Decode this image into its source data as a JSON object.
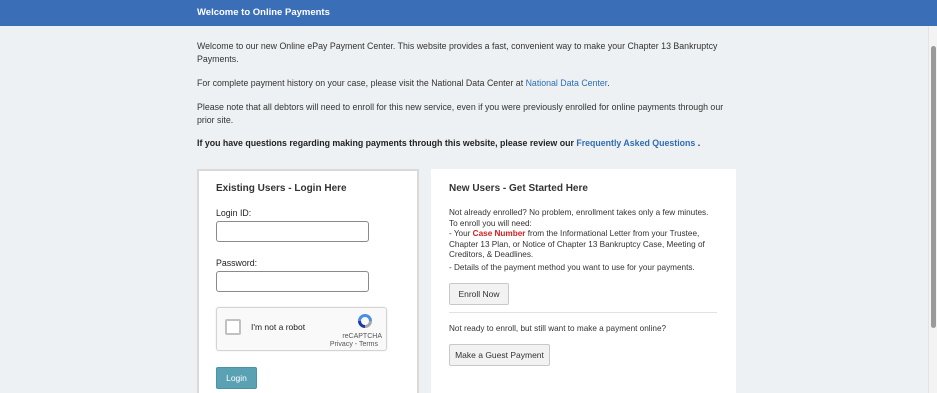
{
  "header": {
    "title": "Welcome to Online Payments"
  },
  "intro": {
    "p1": "Welcome to our new Online ePay Payment Center. This website provides a fast, convenient way to make your Chapter 13 Bankruptcy Payments.",
    "p2_text": "For complete payment history on your case, please visit the National Data Center at ",
    "p2_link": "National Data Center",
    "p2_end": ".",
    "p3": "Please note that all debtors will need to enroll for this new service, even if you were previously enrolled for online payments through our prior site.",
    "p4_text": "If you have questions regarding making payments through this website, please review our ",
    "p4_link": "Frequently Asked Questions",
    "p4_end": " ."
  },
  "login": {
    "heading": "Existing Users - Login Here",
    "login_id_label": "Login ID:",
    "login_id_value": "",
    "password_label": "Password:",
    "password_value": "",
    "captcha_text": "I'm not a robot",
    "captcha_brand": "reCAPTCHA",
    "captcha_privacy": "Privacy",
    "captcha_sep": " - ",
    "captcha_terms": "Terms",
    "login_button": "Login"
  },
  "new_users": {
    "heading": "New Users - Get Started Here",
    "line1": "Not already enrolled? No problem, enrollment takes only a few minutes.",
    "line2": "To enroll you will need:",
    "line3_pre": "- Your ",
    "line3_highlight": "Case Number",
    "line3_post": " from the Informational Letter from your Trustee, Chapter 13 Plan, or Notice of Chapter 13 Bankruptcy Case, Meeting of Creditors, & Deadlines.",
    "line4": "- Details of the payment method you want to use for your payments.",
    "enroll_button": "Enroll Now",
    "guest_text": "Not ready to enroll, but still want to make a payment online?",
    "guest_button": "Make a Guest Payment"
  },
  "colors": {
    "header_bg": "#3a6fb7",
    "link": "#2f6db3",
    "highlight": "#d21f1f",
    "login_button_bg": "#5aa1b4"
  }
}
